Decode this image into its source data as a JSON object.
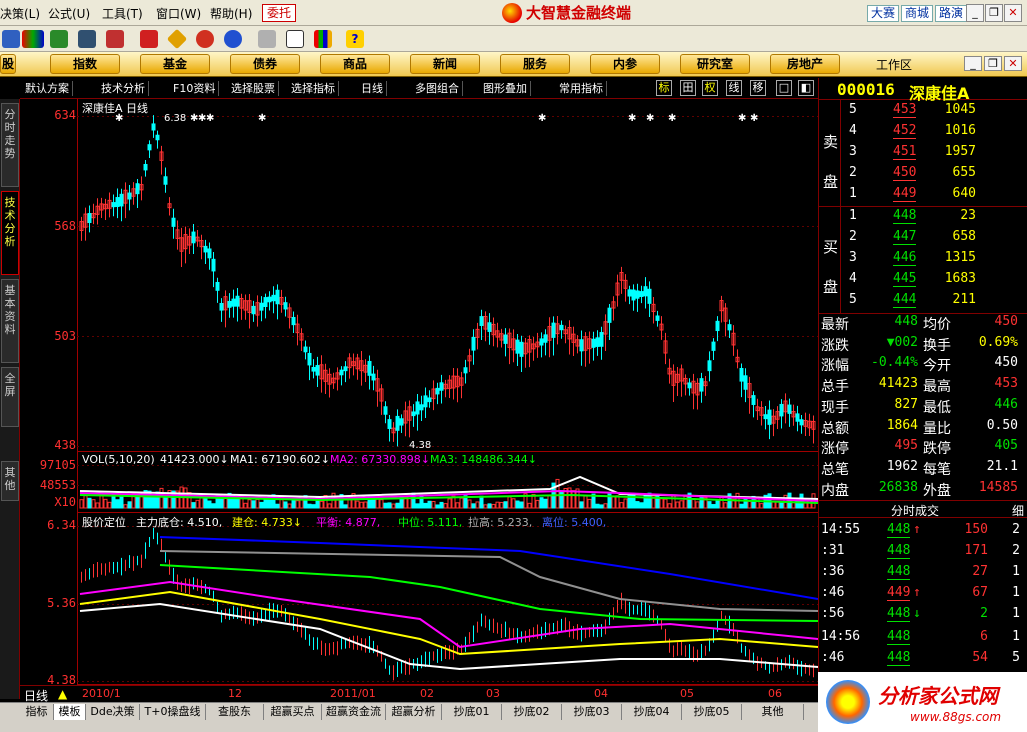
{
  "menu": [
    "决策(L)",
    "公式(U)",
    "工具(T)",
    "窗口(W)",
    "帮助(H)"
  ],
  "weituo": "委托",
  "app_title": "大智慧金融终端",
  "top_links": [
    "大赛",
    "商城",
    "路演"
  ],
  "nav": [
    "股",
    "指数",
    "基金",
    "债券",
    "商品",
    "新闻",
    "服务",
    "内参",
    "研究室",
    "房地产"
  ],
  "workarea": "工作区",
  "atoolbar": [
    "默认方案",
    "技术分析",
    "F10资料",
    "选择股票",
    "选择指标",
    "日线",
    "多图组合",
    "图形叠加",
    "常用指标"
  ],
  "atoolbar_squares": [
    "标",
    "田",
    "权",
    "线",
    "移",
    "□",
    "◧"
  ],
  "left_tabs": [
    "分时走势",
    "技术分析",
    "基本资料",
    "全屏",
    "其他"
  ],
  "price_chart": {
    "title": "深康佳A 日线",
    "y_ticks": [
      "634",
      "568",
      "503",
      "438"
    ],
    "high_label": "6.38",
    "low_label": "4.38"
  },
  "vol": {
    "label": "VOL(5,10,20)",
    "v": "41423.000↓",
    "ma1": "MA1: 67190.602↓",
    "ma2": "MA2: 67330.898↓",
    "ma3": "MA3: 148486.344↓",
    "y_ticks": [
      "97105",
      "48553",
      "X10"
    ]
  },
  "ind": {
    "name": "股价定位",
    "a": "主力底仓: 4.510,",
    "b": "建仓: 4.733↓",
    "c": "平衡: 4.877,",
    "d": "中位: 5.111,",
    "e": "拉高: 5.233,",
    "f": "离位: 5.400,",
    "y_ticks": [
      "6.34",
      "5.36",
      "4.38"
    ]
  },
  "x_axis": [
    "2010/1",
    "12",
    "2011/01",
    "02",
    "03",
    "04",
    "05",
    "06"
  ],
  "period": "日线",
  "stock": {
    "code": "000016",
    "name": "深康佳A"
  },
  "sell_label": "卖盘",
  "buy_label": "买盘",
  "asks": [
    {
      "lv": "5",
      "p": "453",
      "v": "1045"
    },
    {
      "lv": "4",
      "p": "452",
      "v": "1016"
    },
    {
      "lv": "3",
      "p": "451",
      "v": "1957"
    },
    {
      "lv": "2",
      "p": "450",
      "v": "655"
    },
    {
      "lv": "1",
      "p": "449",
      "v": "640"
    }
  ],
  "bids": [
    {
      "lv": "1",
      "p": "448",
      "v": "23"
    },
    {
      "lv": "2",
      "p": "447",
      "v": "658"
    },
    {
      "lv": "3",
      "p": "446",
      "v": "1315"
    },
    {
      "lv": "4",
      "p": "445",
      "v": "1683"
    },
    {
      "lv": "5",
      "p": "444",
      "v": "211"
    }
  ],
  "stats": [
    {
      "l1": "最新",
      "v1": "448",
      "l2": "均价",
      "v2": "450"
    },
    {
      "l1": "涨跌",
      "v1": "▼002",
      "l2": "换手",
      "v2": "0.69%"
    },
    {
      "l1": "涨幅",
      "v1": "-0.44%",
      "l2": "今开",
      "v2": "450"
    },
    {
      "l1": "总手",
      "v1": "41423",
      "l2": "最高",
      "v2": "453"
    },
    {
      "l1": "现手",
      "v1": "827",
      "l2": "最低",
      "v2": "446"
    },
    {
      "l1": "总额",
      "v1": "1864",
      "l2": "量比",
      "v2": "0.50"
    },
    {
      "l1": "涨停",
      "v1": "495",
      "l2": "跌停",
      "v2": "405"
    },
    {
      "l1": "总笔",
      "v1": "1962",
      "l2": "每笔",
      "v2": "21.1"
    },
    {
      "l1": "内盘",
      "v1": "26838",
      "l2": "外盘",
      "v2": "14585"
    }
  ],
  "ticks_title": "分时成交",
  "ticks_btn": "细",
  "ticks": [
    {
      "t": "14:55",
      "p": "448",
      "a": "↑",
      "v": "150",
      "n": "2"
    },
    {
      "t": ":31",
      "p": "448",
      "a": "",
      "v": "171",
      "n": "2"
    },
    {
      "t": ":36",
      "p": "448",
      "a": "",
      "v": "27",
      "n": "1"
    },
    {
      "t": ":46",
      "p": "449",
      "a": "↑",
      "v": "67",
      "n": "1"
    },
    {
      "t": ":56",
      "p": "448",
      "a": "↓",
      "v": "2",
      "n": "1"
    },
    {
      "t": "14:56",
      "p": "448",
      "a": "",
      "v": "6",
      "n": "1"
    },
    {
      "t": ":46",
      "p": "448",
      "a": "",
      "v": "54",
      "n": "5"
    }
  ],
  "bottom_tabs": [
    "指标",
    "模板",
    "Dde决策",
    "T+0操盘线",
    "查股东",
    "超赢买点",
    "超赢资金流",
    "超赢分析",
    "抄底01",
    "抄底02",
    "抄底03",
    "抄底04",
    "抄底05",
    "其他"
  ],
  "watermark": {
    "title": "分析家公式网",
    "url": "www.88gs.com"
  },
  "colors": {
    "up": "#ff3232",
    "down": "#00ffff",
    "green": "#00e000",
    "ma_blue": "#0000ff",
    "ma_gray": "#909090",
    "ma_green": "#00ff00",
    "ma_magenta": "#ff00ff",
    "ma_yellow": "#ffff00",
    "ma_white": "#ffffff"
  }
}
